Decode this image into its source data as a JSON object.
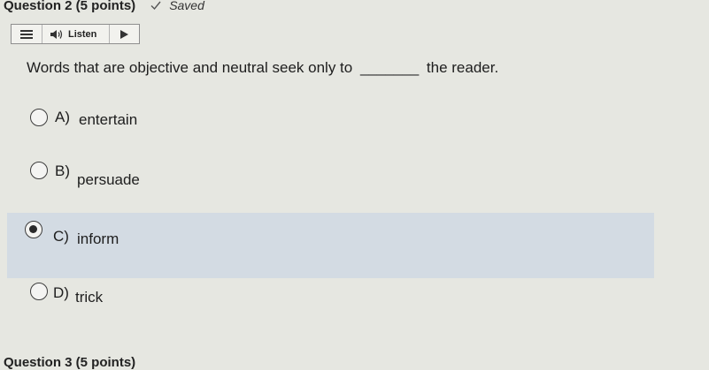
{
  "header": {
    "question_title": "Question 2 (5 points)",
    "saved_label": "Saved"
  },
  "toolbar": {
    "menu_icon": "menu-icon",
    "listen_label": "Listen",
    "speaker_icon": "speaker-icon",
    "play_icon": "play-icon"
  },
  "question": {
    "text_before": "Words that are objective and neutral seek only to",
    "blank": "_______",
    "text_after": "the reader."
  },
  "options": [
    {
      "letter": "A)",
      "text": "entertain",
      "selected": false
    },
    {
      "letter": "B)",
      "text": "persuade",
      "selected": false
    },
    {
      "letter": "C)",
      "text": "inform",
      "selected": true
    },
    {
      "letter": "D)",
      "text": "trick",
      "selected": false
    }
  ],
  "next_question": {
    "title": "Question 3 (5 points)"
  },
  "colors": {
    "background": "#e6e7e1",
    "selected_row": "#d3dbe3"
  }
}
